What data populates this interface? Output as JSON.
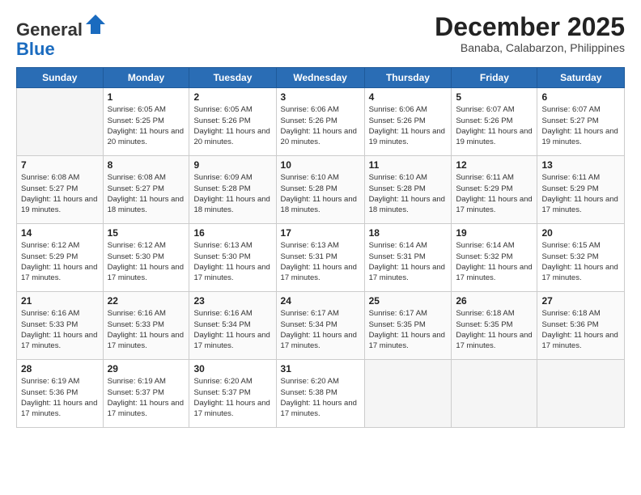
{
  "header": {
    "logo_general": "General",
    "logo_blue": "Blue",
    "month_title": "December 2025",
    "location": "Banaba, Calabarzon, Philippines"
  },
  "days_of_week": [
    "Sunday",
    "Monday",
    "Tuesday",
    "Wednesday",
    "Thursday",
    "Friday",
    "Saturday"
  ],
  "weeks": [
    [
      {
        "day": "",
        "empty": true
      },
      {
        "day": "1",
        "sunrise": "Sunrise: 6:05 AM",
        "sunset": "Sunset: 5:25 PM",
        "daylight": "Daylight: 11 hours and 20 minutes."
      },
      {
        "day": "2",
        "sunrise": "Sunrise: 6:05 AM",
        "sunset": "Sunset: 5:26 PM",
        "daylight": "Daylight: 11 hours and 20 minutes."
      },
      {
        "day": "3",
        "sunrise": "Sunrise: 6:06 AM",
        "sunset": "Sunset: 5:26 PM",
        "daylight": "Daylight: 11 hours and 20 minutes."
      },
      {
        "day": "4",
        "sunrise": "Sunrise: 6:06 AM",
        "sunset": "Sunset: 5:26 PM",
        "daylight": "Daylight: 11 hours and 19 minutes."
      },
      {
        "day": "5",
        "sunrise": "Sunrise: 6:07 AM",
        "sunset": "Sunset: 5:26 PM",
        "daylight": "Daylight: 11 hours and 19 minutes."
      },
      {
        "day": "6",
        "sunrise": "Sunrise: 6:07 AM",
        "sunset": "Sunset: 5:27 PM",
        "daylight": "Daylight: 11 hours and 19 minutes."
      }
    ],
    [
      {
        "day": "7",
        "sunrise": "Sunrise: 6:08 AM",
        "sunset": "Sunset: 5:27 PM",
        "daylight": "Daylight: 11 hours and 19 minutes."
      },
      {
        "day": "8",
        "sunrise": "Sunrise: 6:08 AM",
        "sunset": "Sunset: 5:27 PM",
        "daylight": "Daylight: 11 hours and 18 minutes."
      },
      {
        "day": "9",
        "sunrise": "Sunrise: 6:09 AM",
        "sunset": "Sunset: 5:28 PM",
        "daylight": "Daylight: 11 hours and 18 minutes."
      },
      {
        "day": "10",
        "sunrise": "Sunrise: 6:10 AM",
        "sunset": "Sunset: 5:28 PM",
        "daylight": "Daylight: 11 hours and 18 minutes."
      },
      {
        "day": "11",
        "sunrise": "Sunrise: 6:10 AM",
        "sunset": "Sunset: 5:28 PM",
        "daylight": "Daylight: 11 hours and 18 minutes."
      },
      {
        "day": "12",
        "sunrise": "Sunrise: 6:11 AM",
        "sunset": "Sunset: 5:29 PM",
        "daylight": "Daylight: 11 hours and 17 minutes."
      },
      {
        "day": "13",
        "sunrise": "Sunrise: 6:11 AM",
        "sunset": "Sunset: 5:29 PM",
        "daylight": "Daylight: 11 hours and 17 minutes."
      }
    ],
    [
      {
        "day": "14",
        "sunrise": "Sunrise: 6:12 AM",
        "sunset": "Sunset: 5:29 PM",
        "daylight": "Daylight: 11 hours and 17 minutes."
      },
      {
        "day": "15",
        "sunrise": "Sunrise: 6:12 AM",
        "sunset": "Sunset: 5:30 PM",
        "daylight": "Daylight: 11 hours and 17 minutes."
      },
      {
        "day": "16",
        "sunrise": "Sunrise: 6:13 AM",
        "sunset": "Sunset: 5:30 PM",
        "daylight": "Daylight: 11 hours and 17 minutes."
      },
      {
        "day": "17",
        "sunrise": "Sunrise: 6:13 AM",
        "sunset": "Sunset: 5:31 PM",
        "daylight": "Daylight: 11 hours and 17 minutes."
      },
      {
        "day": "18",
        "sunrise": "Sunrise: 6:14 AM",
        "sunset": "Sunset: 5:31 PM",
        "daylight": "Daylight: 11 hours and 17 minutes."
      },
      {
        "day": "19",
        "sunrise": "Sunrise: 6:14 AM",
        "sunset": "Sunset: 5:32 PM",
        "daylight": "Daylight: 11 hours and 17 minutes."
      },
      {
        "day": "20",
        "sunrise": "Sunrise: 6:15 AM",
        "sunset": "Sunset: 5:32 PM",
        "daylight": "Daylight: 11 hours and 17 minutes."
      }
    ],
    [
      {
        "day": "21",
        "sunrise": "Sunrise: 6:16 AM",
        "sunset": "Sunset: 5:33 PM",
        "daylight": "Daylight: 11 hours and 17 minutes."
      },
      {
        "day": "22",
        "sunrise": "Sunrise: 6:16 AM",
        "sunset": "Sunset: 5:33 PM",
        "daylight": "Daylight: 11 hours and 17 minutes."
      },
      {
        "day": "23",
        "sunrise": "Sunrise: 6:16 AM",
        "sunset": "Sunset: 5:34 PM",
        "daylight": "Daylight: 11 hours and 17 minutes."
      },
      {
        "day": "24",
        "sunrise": "Sunrise: 6:17 AM",
        "sunset": "Sunset: 5:34 PM",
        "daylight": "Daylight: 11 hours and 17 minutes."
      },
      {
        "day": "25",
        "sunrise": "Sunrise: 6:17 AM",
        "sunset": "Sunset: 5:35 PM",
        "daylight": "Daylight: 11 hours and 17 minutes."
      },
      {
        "day": "26",
        "sunrise": "Sunrise: 6:18 AM",
        "sunset": "Sunset: 5:35 PM",
        "daylight": "Daylight: 11 hours and 17 minutes."
      },
      {
        "day": "27",
        "sunrise": "Sunrise: 6:18 AM",
        "sunset": "Sunset: 5:36 PM",
        "daylight": "Daylight: 11 hours and 17 minutes."
      }
    ],
    [
      {
        "day": "28",
        "sunrise": "Sunrise: 6:19 AM",
        "sunset": "Sunset: 5:36 PM",
        "daylight": "Daylight: 11 hours and 17 minutes."
      },
      {
        "day": "29",
        "sunrise": "Sunrise: 6:19 AM",
        "sunset": "Sunset: 5:37 PM",
        "daylight": "Daylight: 11 hours and 17 minutes."
      },
      {
        "day": "30",
        "sunrise": "Sunrise: 6:20 AM",
        "sunset": "Sunset: 5:37 PM",
        "daylight": "Daylight: 11 hours and 17 minutes."
      },
      {
        "day": "31",
        "sunrise": "Sunrise: 6:20 AM",
        "sunset": "Sunset: 5:38 PM",
        "daylight": "Daylight: 11 hours and 17 minutes."
      },
      {
        "day": "",
        "empty": true
      },
      {
        "day": "",
        "empty": true
      },
      {
        "day": "",
        "empty": true
      }
    ]
  ]
}
